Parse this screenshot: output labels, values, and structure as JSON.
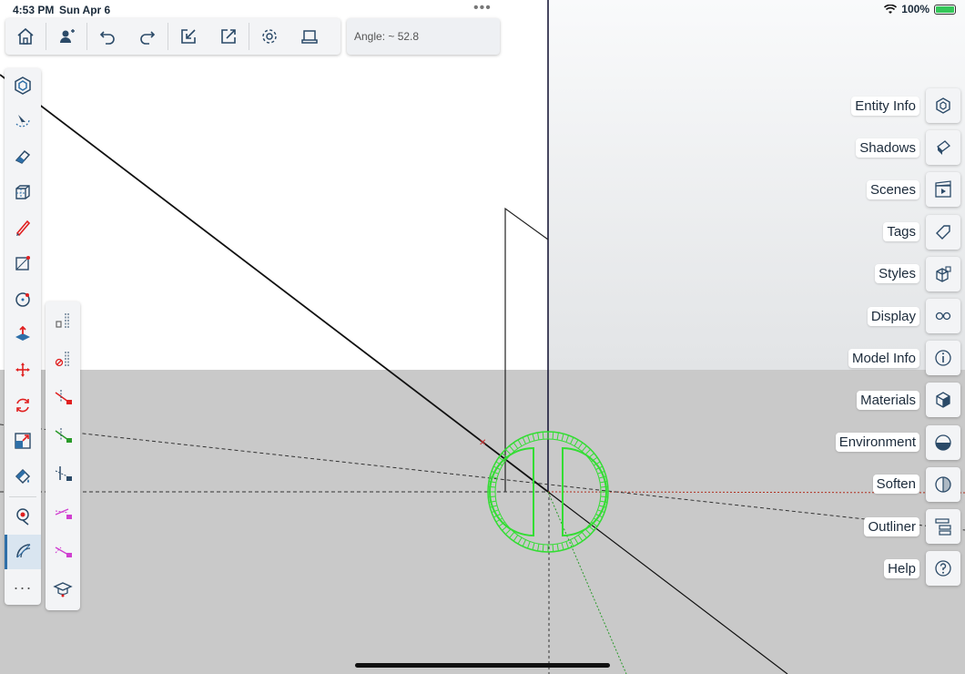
{
  "status_bar": {
    "time": "4:53 PM",
    "date": "Sun Apr 6",
    "more": "•••",
    "battery_text": "100%",
    "battery_level": 1.0
  },
  "toolbar": {
    "buttons": [
      "home-icon",
      "add-user-icon",
      "undo-icon",
      "redo-icon",
      "import-icon",
      "export-icon",
      "gear-icon",
      "tray-icon"
    ]
  },
  "angle": {
    "label": "Angle: ~ 52.8"
  },
  "left_tools": {
    "items": [
      "select-icon",
      "orbit-icon",
      "eraser-icon",
      "box-icon",
      "pencil-icon",
      "rectangle-icon",
      "circle-icon",
      "push-pull-icon",
      "move-icon",
      "rotate-icon",
      "scale-icon",
      "paint-bucket-icon",
      "tape-measure-icon",
      "protractor-icon"
    ],
    "active": "protractor-icon",
    "more": "···"
  },
  "sub_tools": {
    "items": [
      "delete-guides-icon",
      "hide-guides-icon",
      "lock-red-axis-icon",
      "lock-green-axis-icon",
      "lock-blue-axis-icon",
      "lock-magenta-icon",
      "lock-magenta-2-icon",
      "instructor-icon"
    ]
  },
  "right_panels": [
    {
      "label": "Entity Info",
      "icon": "entity-info-icon"
    },
    {
      "label": "Shadows",
      "icon": "shadows-icon"
    },
    {
      "label": "Scenes",
      "icon": "scenes-icon"
    },
    {
      "label": "Tags",
      "icon": "tags-icon"
    },
    {
      "label": "Styles",
      "icon": "styles-icon"
    },
    {
      "label": "Display",
      "icon": "display-icon"
    },
    {
      "label": "Model Info",
      "icon": "info-icon"
    },
    {
      "label": "Materials",
      "icon": "materials-icon"
    },
    {
      "label": "Environment",
      "icon": "environment-icon"
    },
    {
      "label": "Soften",
      "icon": "soften-icon"
    },
    {
      "label": "Outliner",
      "icon": "outliner-icon"
    },
    {
      "label": "Help",
      "icon": "help-icon"
    }
  ],
  "colors": {
    "accent": "#2e6fa8",
    "protractor": "#33dd33",
    "axis_red": "#b03020",
    "axis_green": "#2a9a2a",
    "tool_red": "#e02020"
  }
}
